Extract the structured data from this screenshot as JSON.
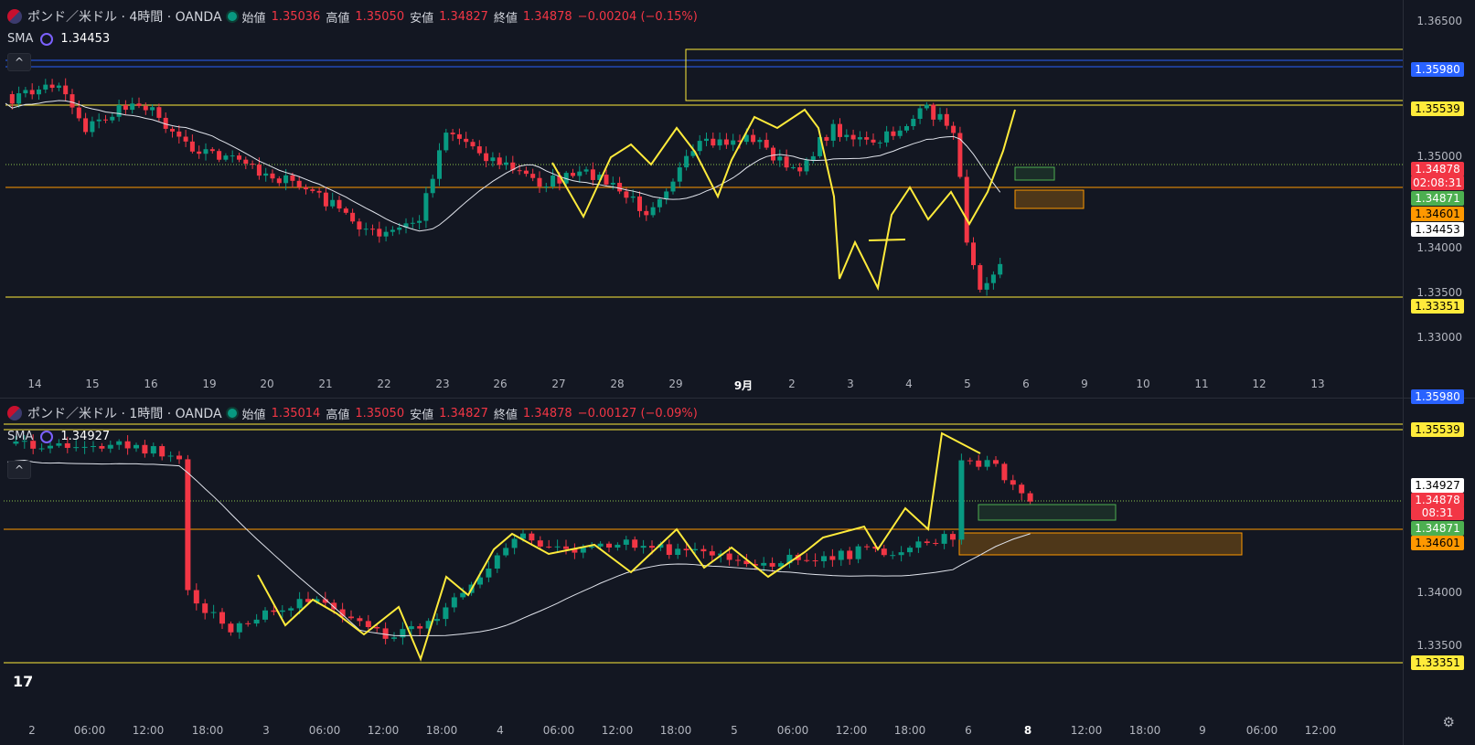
{
  "top": {
    "symbol": "ポンド／米ドル · 4時間 · OANDA",
    "open_label": "始値",
    "open": "1.35036",
    "high_label": "高値",
    "high": "1.35050",
    "low_label": "安値",
    "low": "1.34827",
    "close_label": "終値",
    "close": "1.34878",
    "change": "−0.00204 (−0.15%)",
    "sma_label": "SMA",
    "sma_value": "1.34453",
    "price_ticks": [
      "1.36500",
      "1.35000",
      "1.34000",
      "1.33500",
      "1.33000"
    ],
    "labels": {
      "blue": "1.35980",
      "yellow_high": "1.35539",
      "last": "1.34878",
      "countdown": "02:08:31",
      "green": "1.34871",
      "orange": "1.34601",
      "sma": "1.34453",
      "yellow_low": "1.33351"
    },
    "time_labels": [
      "14",
      "15",
      "16",
      "19",
      "20",
      "21",
      "22",
      "23",
      "26",
      "27",
      "28",
      "29",
      "9月",
      "2",
      "3",
      "4",
      "5",
      "6",
      "9",
      "10",
      "11",
      "12",
      "13"
    ]
  },
  "bottom": {
    "symbol": "ポンド／米ドル · 1時間 · OANDA",
    "open_label": "始値",
    "open": "1.35014",
    "high_label": "高値",
    "high": "1.35050",
    "low_label": "安値",
    "low": "1.34827",
    "close_label": "終値",
    "close": "1.34878",
    "change": "−0.00127 (−0.09%)",
    "sma_label": "SMA",
    "sma_value": "1.34927",
    "price_ticks": [
      "1.34000",
      "1.33500"
    ],
    "labels": {
      "blue": "1.35980",
      "yellow_high": "1.35539",
      "sma": "1.34927",
      "last": "1.34878",
      "countdown": "08:31",
      "green": "1.34871",
      "orange": "1.34601",
      "yellow_low": "1.33351"
    },
    "time_labels": [
      "2",
      "06:00",
      "12:00",
      "18:00",
      "3",
      "06:00",
      "12:00",
      "18:00",
      "4",
      "06:00",
      "12:00",
      "18:00",
      "5",
      "06:00",
      "12:00",
      "18:00",
      "6",
      "8",
      "12:00",
      "18:00",
      "9",
      "06:00",
      "12:00"
    ]
  },
  "colors": {
    "up": "#089981",
    "down": "#f23645",
    "yellow": "#ffeb3b",
    "blue": "#2962ff",
    "orange": "#ff9800",
    "green": "#4caf50",
    "bg": "#131722"
  },
  "icons": {
    "logo": "tradingview-logo",
    "settings": "gear-icon"
  }
}
